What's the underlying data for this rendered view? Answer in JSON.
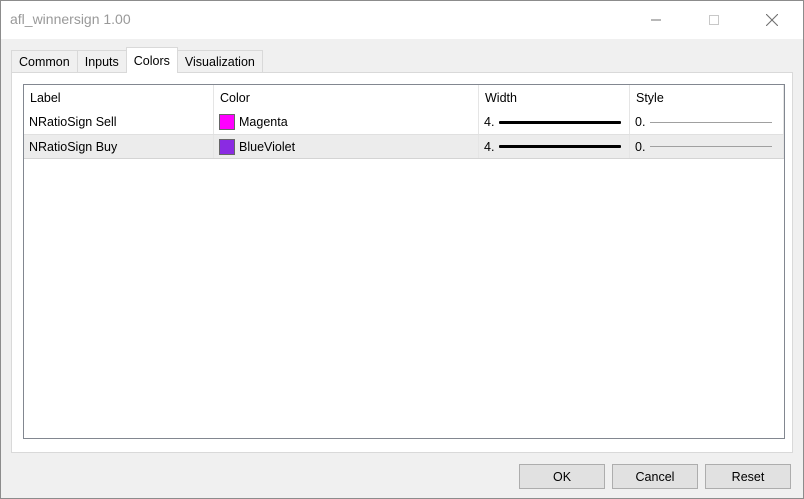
{
  "window": {
    "title": "afl_winnersign 1.00"
  },
  "tabs": [
    {
      "label": "Common",
      "active": false
    },
    {
      "label": "Inputs",
      "active": false
    },
    {
      "label": "Colors",
      "active": true
    },
    {
      "label": "Visualization",
      "active": false
    }
  ],
  "grid": {
    "columns": [
      "Label",
      "Color",
      "Width",
      "Style"
    ],
    "rows": [
      {
        "label": "NRatioSign Sell",
        "color_name": "Magenta",
        "color_hex": "#ff00ff",
        "width": "4.",
        "style": "0.",
        "selected": false
      },
      {
        "label": "NRatioSign Buy",
        "color_name": "BlueViolet",
        "color_hex": "#8a2be2",
        "width": "4.",
        "style": "0.",
        "selected": true
      }
    ]
  },
  "buttons": {
    "ok": "OK",
    "cancel": "Cancel",
    "reset": "Reset"
  }
}
